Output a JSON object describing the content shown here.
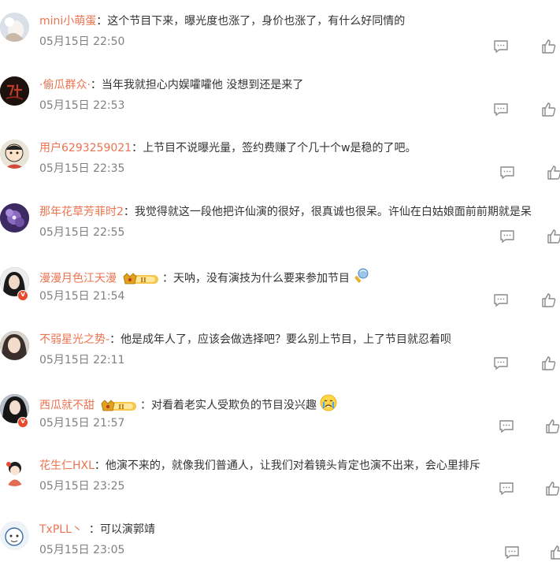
{
  "comments": [
    {
      "user": "mini小萌蛋",
      "sep": "：",
      "text": "这个节目下来，曝光度也涨了，身价也涨了，有什么好同情的",
      "time": "05月15日 22:50",
      "avatar_color": "#cfd6de"
    },
    {
      "user": "·偷瓜群众·",
      "sep": "：",
      "text": "当年我就担心内娱嚯嚯他 没想到还是来了",
      "time": "05月15日 22:53",
      "avatar_color": "#2b1a14"
    },
    {
      "user": "用户6293259021",
      "sep": "：",
      "text": "上节目不说曝光量，签约费赚了个几十个w是稳的了吧。",
      "time": "05月15日 22:35",
      "avatar_color": "#e9e4d8"
    },
    {
      "user": "那年花草芳菲时2",
      "sep": "：",
      "text": "我觉得就这一段他把许仙演的很好，很真诚也很呆。许仙在白姑娘面前前期就是呆",
      "time": "05月15日 22:55",
      "avatar_color": "#5b3d84"
    },
    {
      "user": "漫漫月色江天漫",
      "sep": "：",
      "text": "天呐，没有演技为什么要来参加节目",
      "time": "05月15日 21:54",
      "avatar_color": "#3a3a3a",
      "verified": true,
      "level": "II"
    },
    {
      "user": "不弱星光之势-",
      "sep": "：",
      "text": "他是成年人了，应该会做选择吧？要么别上节目，上了节目就忍着呗",
      "time": "05月15日 22:11",
      "avatar_color": "#4a4440"
    },
    {
      "user": "西瓜就不甜",
      "sep": "：",
      "text": "对看着老实人受欺负的节目没兴趣",
      "time": "05月15日 21:57",
      "avatar_color": "#2c2c34",
      "verified": true,
      "level": "II"
    },
    {
      "user": "花生仁HXL",
      "sep": "：",
      "text": "他演不来的，就像我们普通人，让我们对着镜头肯定也演不出来，会心里排斥",
      "time": "05月15日 23:25",
      "avatar_color": "#f2e6de"
    },
    {
      "user": "TxPLL丶",
      "sep": "：",
      "text": "可以演郭靖",
      "time": "05月15日 23:05",
      "avatar_color": "#e4eef6"
    }
  ],
  "colors": {
    "username": "#eb7350",
    "text": "#333333",
    "time": "#808080",
    "icon": "#8a8a8a"
  }
}
